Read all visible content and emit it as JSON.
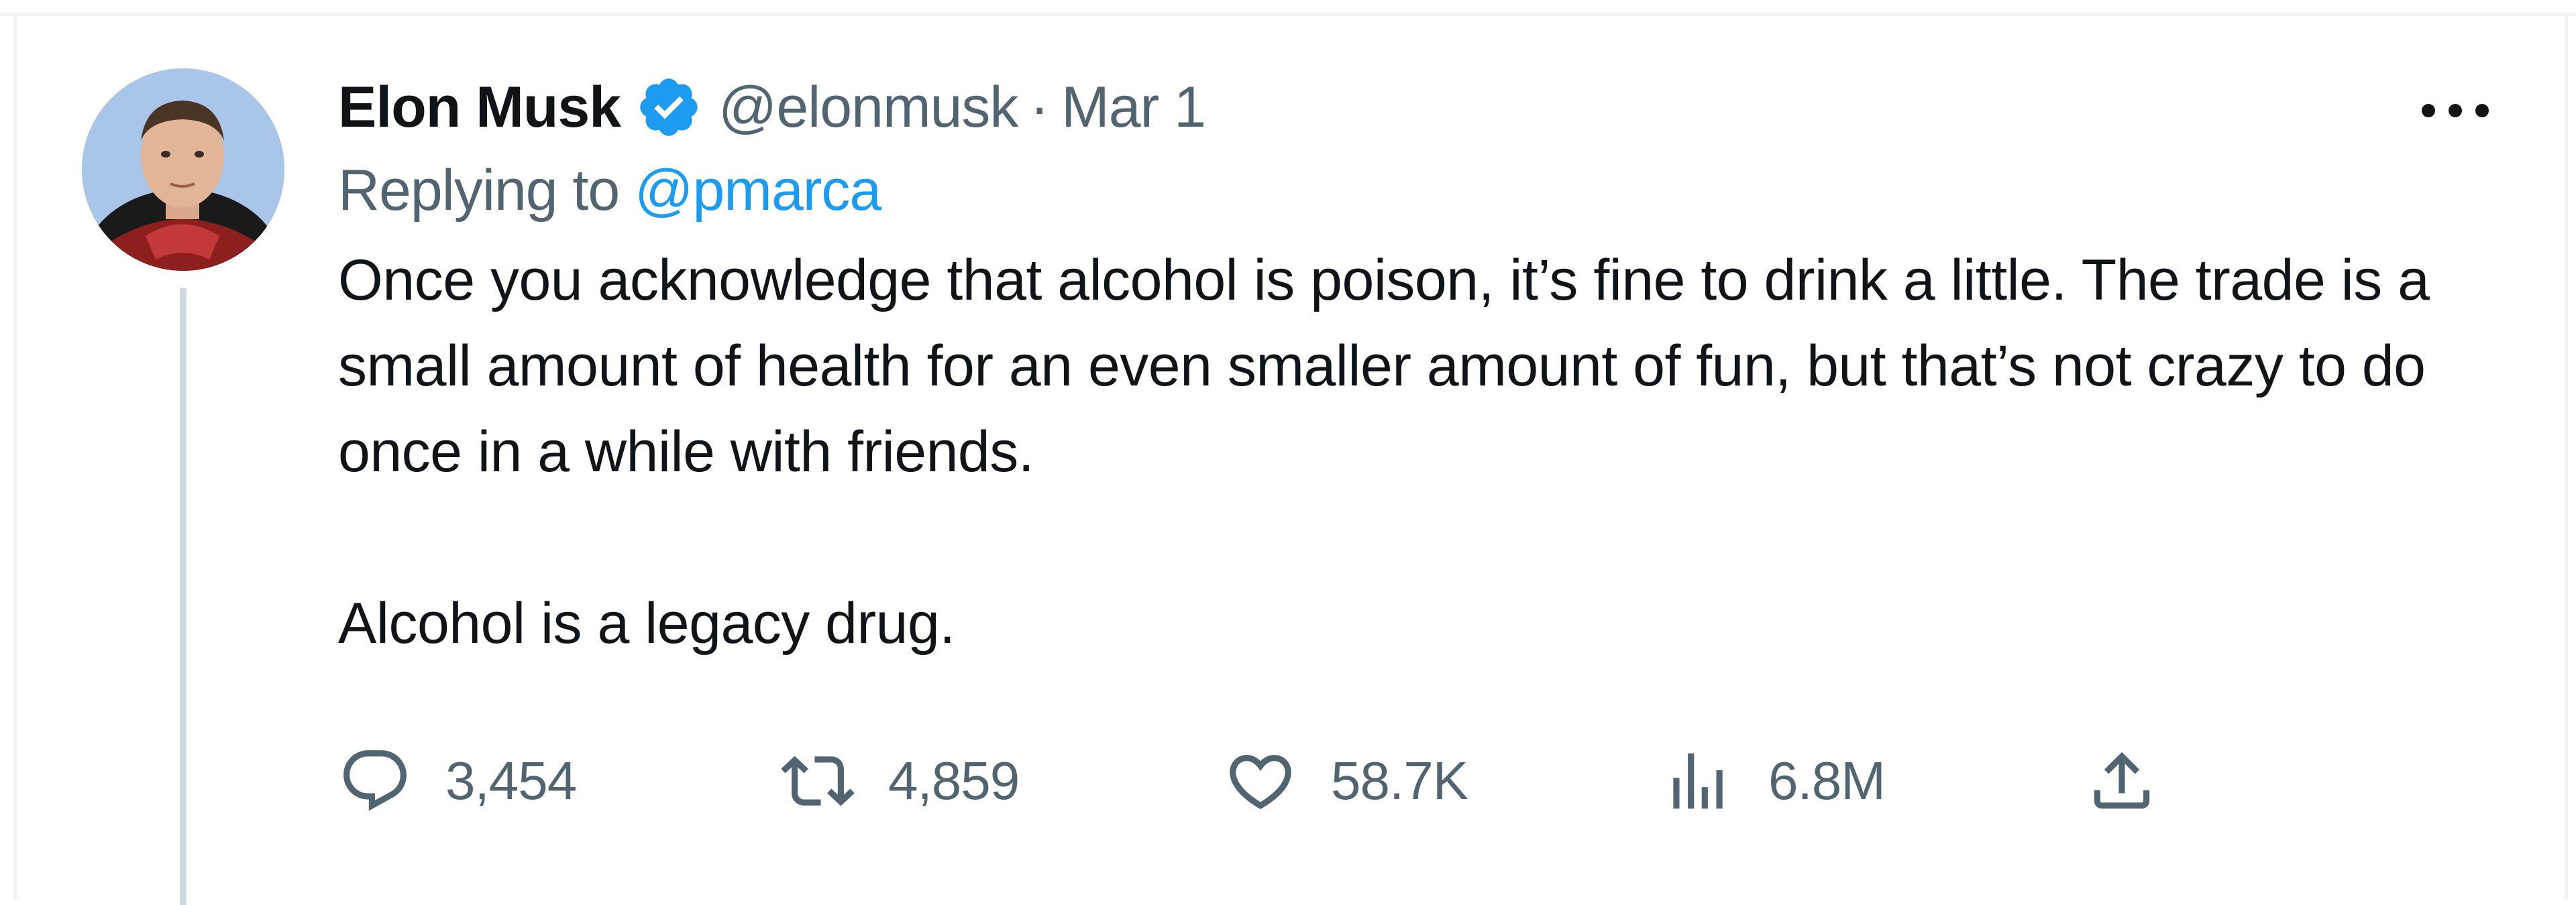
{
  "tweet": {
    "author": {
      "name": "Elon Musk",
      "handle": "@elonmusk",
      "verified": true
    },
    "separator": "·",
    "date": "Mar 1",
    "replying_label": "Replying to",
    "replying_to": "@pmarca",
    "paragraphs": [
      "Once you acknowledge that alcohol is poison, it’s fine to drink a little. The trade is a small amount of health for an even smaller amount of fun, but that’s not crazy to do once in a while with friends.",
      "Alcohol is a legacy drug."
    ],
    "actions": {
      "reply_count": "3,454",
      "retweet_count": "4,859",
      "like_count": "58.7K",
      "views_count": "6.8M"
    }
  },
  "icons": {
    "verified": "verified-badge-icon",
    "more": "more-dots-icon",
    "reply": "reply-bubble-icon",
    "retweet": "retweet-icon",
    "like": "heart-icon",
    "views": "views-bar-chart-icon",
    "share": "share-upload-icon"
  },
  "colors": {
    "accent": "#1d9bf0",
    "secondary_text": "#536471",
    "primary_text": "#0f1419",
    "border": "#eff3f4",
    "thread_line": "#cfd9de"
  }
}
